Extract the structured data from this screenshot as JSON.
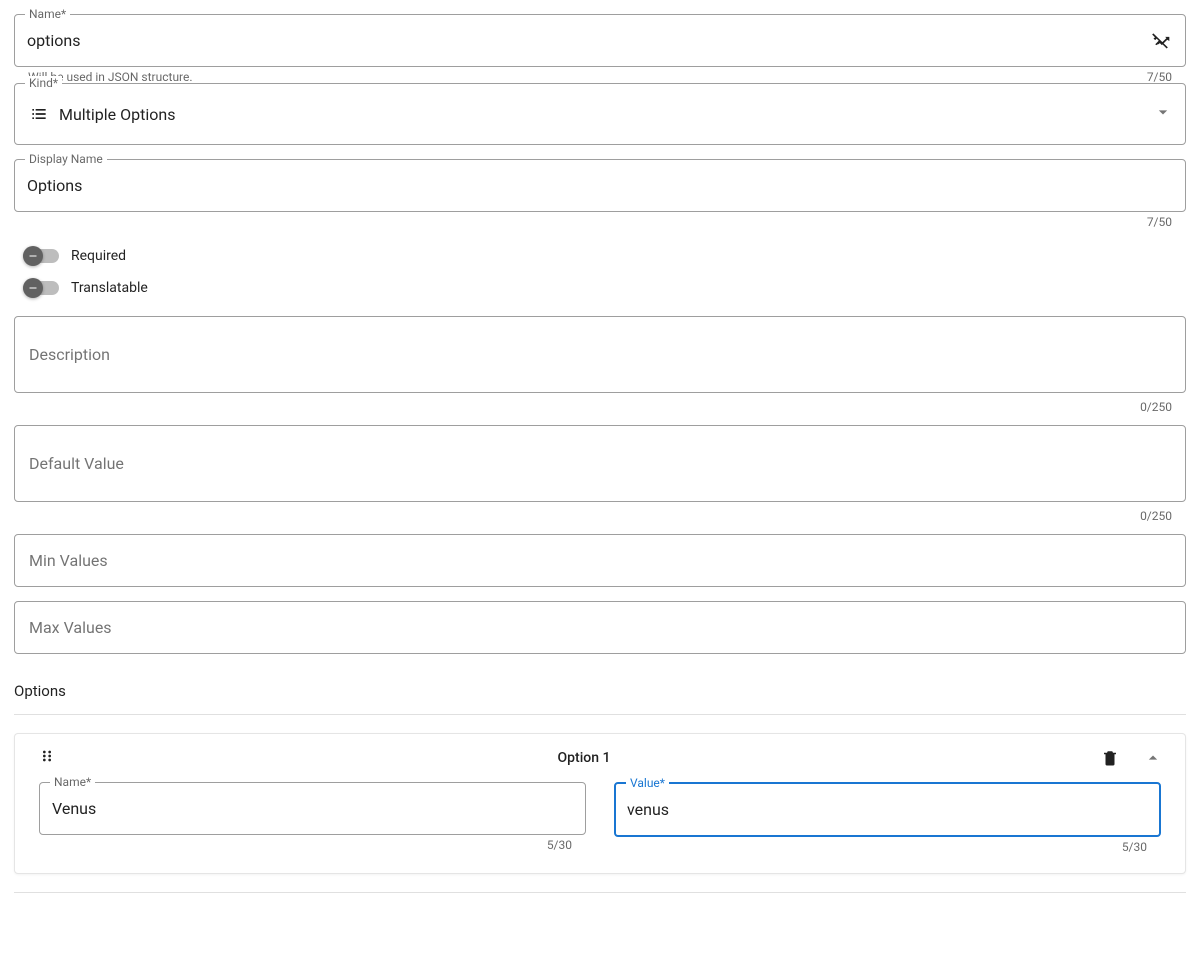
{
  "name_field": {
    "label": "Name*",
    "value": "options",
    "helper": "Will be used in JSON structure.",
    "counter": "7/50"
  },
  "kind_field": {
    "label": "Kind*",
    "value": "Multiple Options"
  },
  "display_name_field": {
    "label": "Display Name",
    "value": "Options",
    "counter": "7/50"
  },
  "switches": {
    "required": "Required",
    "translatable": "Translatable"
  },
  "description_field": {
    "placeholder": "Description",
    "counter": "0/250"
  },
  "default_value_field": {
    "placeholder": "Default Value",
    "counter": "0/250"
  },
  "min_values_field": {
    "placeholder": "Min Values"
  },
  "max_values_field": {
    "placeholder": "Max Values"
  },
  "options_section": {
    "title": "Options"
  },
  "option1": {
    "title": "Option 1",
    "name_label": "Name*",
    "name_value": "Venus",
    "name_counter": "5/30",
    "value_label": "Value*",
    "value_value": "venus",
    "value_counter": "5/30"
  }
}
